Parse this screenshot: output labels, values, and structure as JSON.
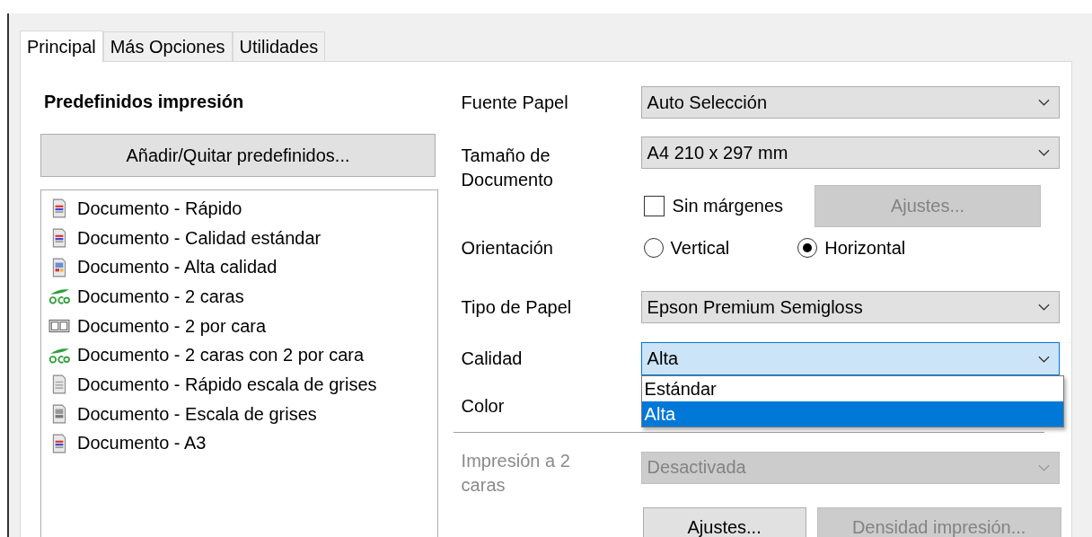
{
  "tabs": [
    {
      "label": "Principal",
      "selected": true
    },
    {
      "label": "Más Opciones",
      "selected": false
    },
    {
      "label": "Utilidades",
      "selected": false
    }
  ],
  "presets": {
    "title": "Predefinidos impresión",
    "button": "Añadir/Quitar predefinidos...",
    "items": [
      {
        "label": "Documento - Rápido",
        "kind": "color_doc"
      },
      {
        "label": "Documento - Calidad estándar",
        "kind": "color_doc"
      },
      {
        "label": "Documento - Alta calidad",
        "kind": "photo_doc"
      },
      {
        "label": "Documento - 2 caras",
        "kind": "eco"
      },
      {
        "label": "Documento - 2 por cara",
        "kind": "two_up"
      },
      {
        "label": "Documento - 2 caras con 2 por cara",
        "kind": "eco"
      },
      {
        "label": "Documento - Rápido escala de grises",
        "kind": "gray_doc"
      },
      {
        "label": "Documento - Escala de grises",
        "kind": "gray_photo"
      },
      {
        "label": "Documento - A3",
        "kind": "color_doc"
      }
    ]
  },
  "paper_source": {
    "label": "Fuente Papel",
    "value": "Auto Selección"
  },
  "document_size": {
    "label": "Tamaño de Documento",
    "value": "A4 210 x 297 mm"
  },
  "borderless": {
    "label": "Sin márgenes",
    "checked": false
  },
  "borderless_settings": {
    "label": "Ajustes...",
    "disabled": true
  },
  "orientation": {
    "label": "Orientación",
    "options": [
      {
        "label": "Vertical",
        "selected": false
      },
      {
        "label": "Horizontal",
        "selected": true
      }
    ]
  },
  "paper_type": {
    "label": "Tipo de Papel",
    "value": "Epson Premium Semigloss"
  },
  "quality": {
    "label": "Calidad",
    "value": "Alta",
    "expanded": true,
    "options": [
      {
        "label": "Estándar",
        "selected": false
      },
      {
        "label": "Alta",
        "selected": true
      }
    ]
  },
  "color": {
    "label": "Color"
  },
  "duplex": {
    "label": "Impresión a 2 caras",
    "value": "Desactivada",
    "disabled": true
  },
  "buttons": [
    {
      "label": "Ajustes...",
      "disabled": false
    },
    {
      "label": "Densidad impresión...",
      "disabled": true
    }
  ]
}
